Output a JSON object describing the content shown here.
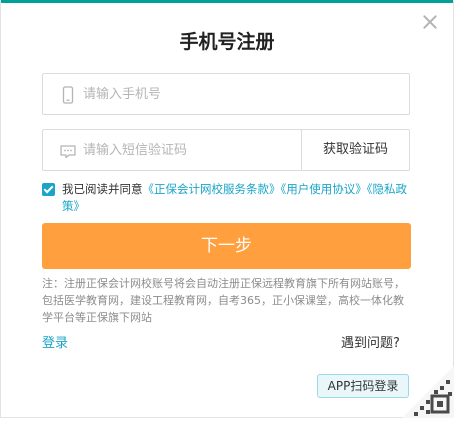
{
  "dialog": {
    "title": "手机号注册"
  },
  "phone_field": {
    "placeholder": "请输入手机号",
    "icon": "mobile-phone-icon"
  },
  "sms_field": {
    "placeholder": "请输入短信验证码",
    "icon": "message-dots-icon",
    "button_label": "获取验证码"
  },
  "agreement": {
    "checked": true,
    "prefix": "我已阅读并同意",
    "links": [
      "《正保会计网校服务条款》",
      "《用户使用协议》",
      "《隐私政策》"
    ]
  },
  "next_button": {
    "label": "下一步"
  },
  "note": "注：注册正保会计网校账号将会自动注册正保远程教育旗下所有网站账号，包括医学教育网，建设工程教育网，自考365，正小保课堂，高校一体化教学平台等正保旗下网站",
  "footer": {
    "login_label": "登录",
    "help_label": "遇到问题?"
  },
  "app_login": {
    "label": "APP扫码登录",
    "icon": "qr-code-icon"
  },
  "colors": {
    "accent_teal": "#1aa5c8",
    "primary_orange": "#ff9f3d",
    "top_strip": "#00a19a"
  }
}
